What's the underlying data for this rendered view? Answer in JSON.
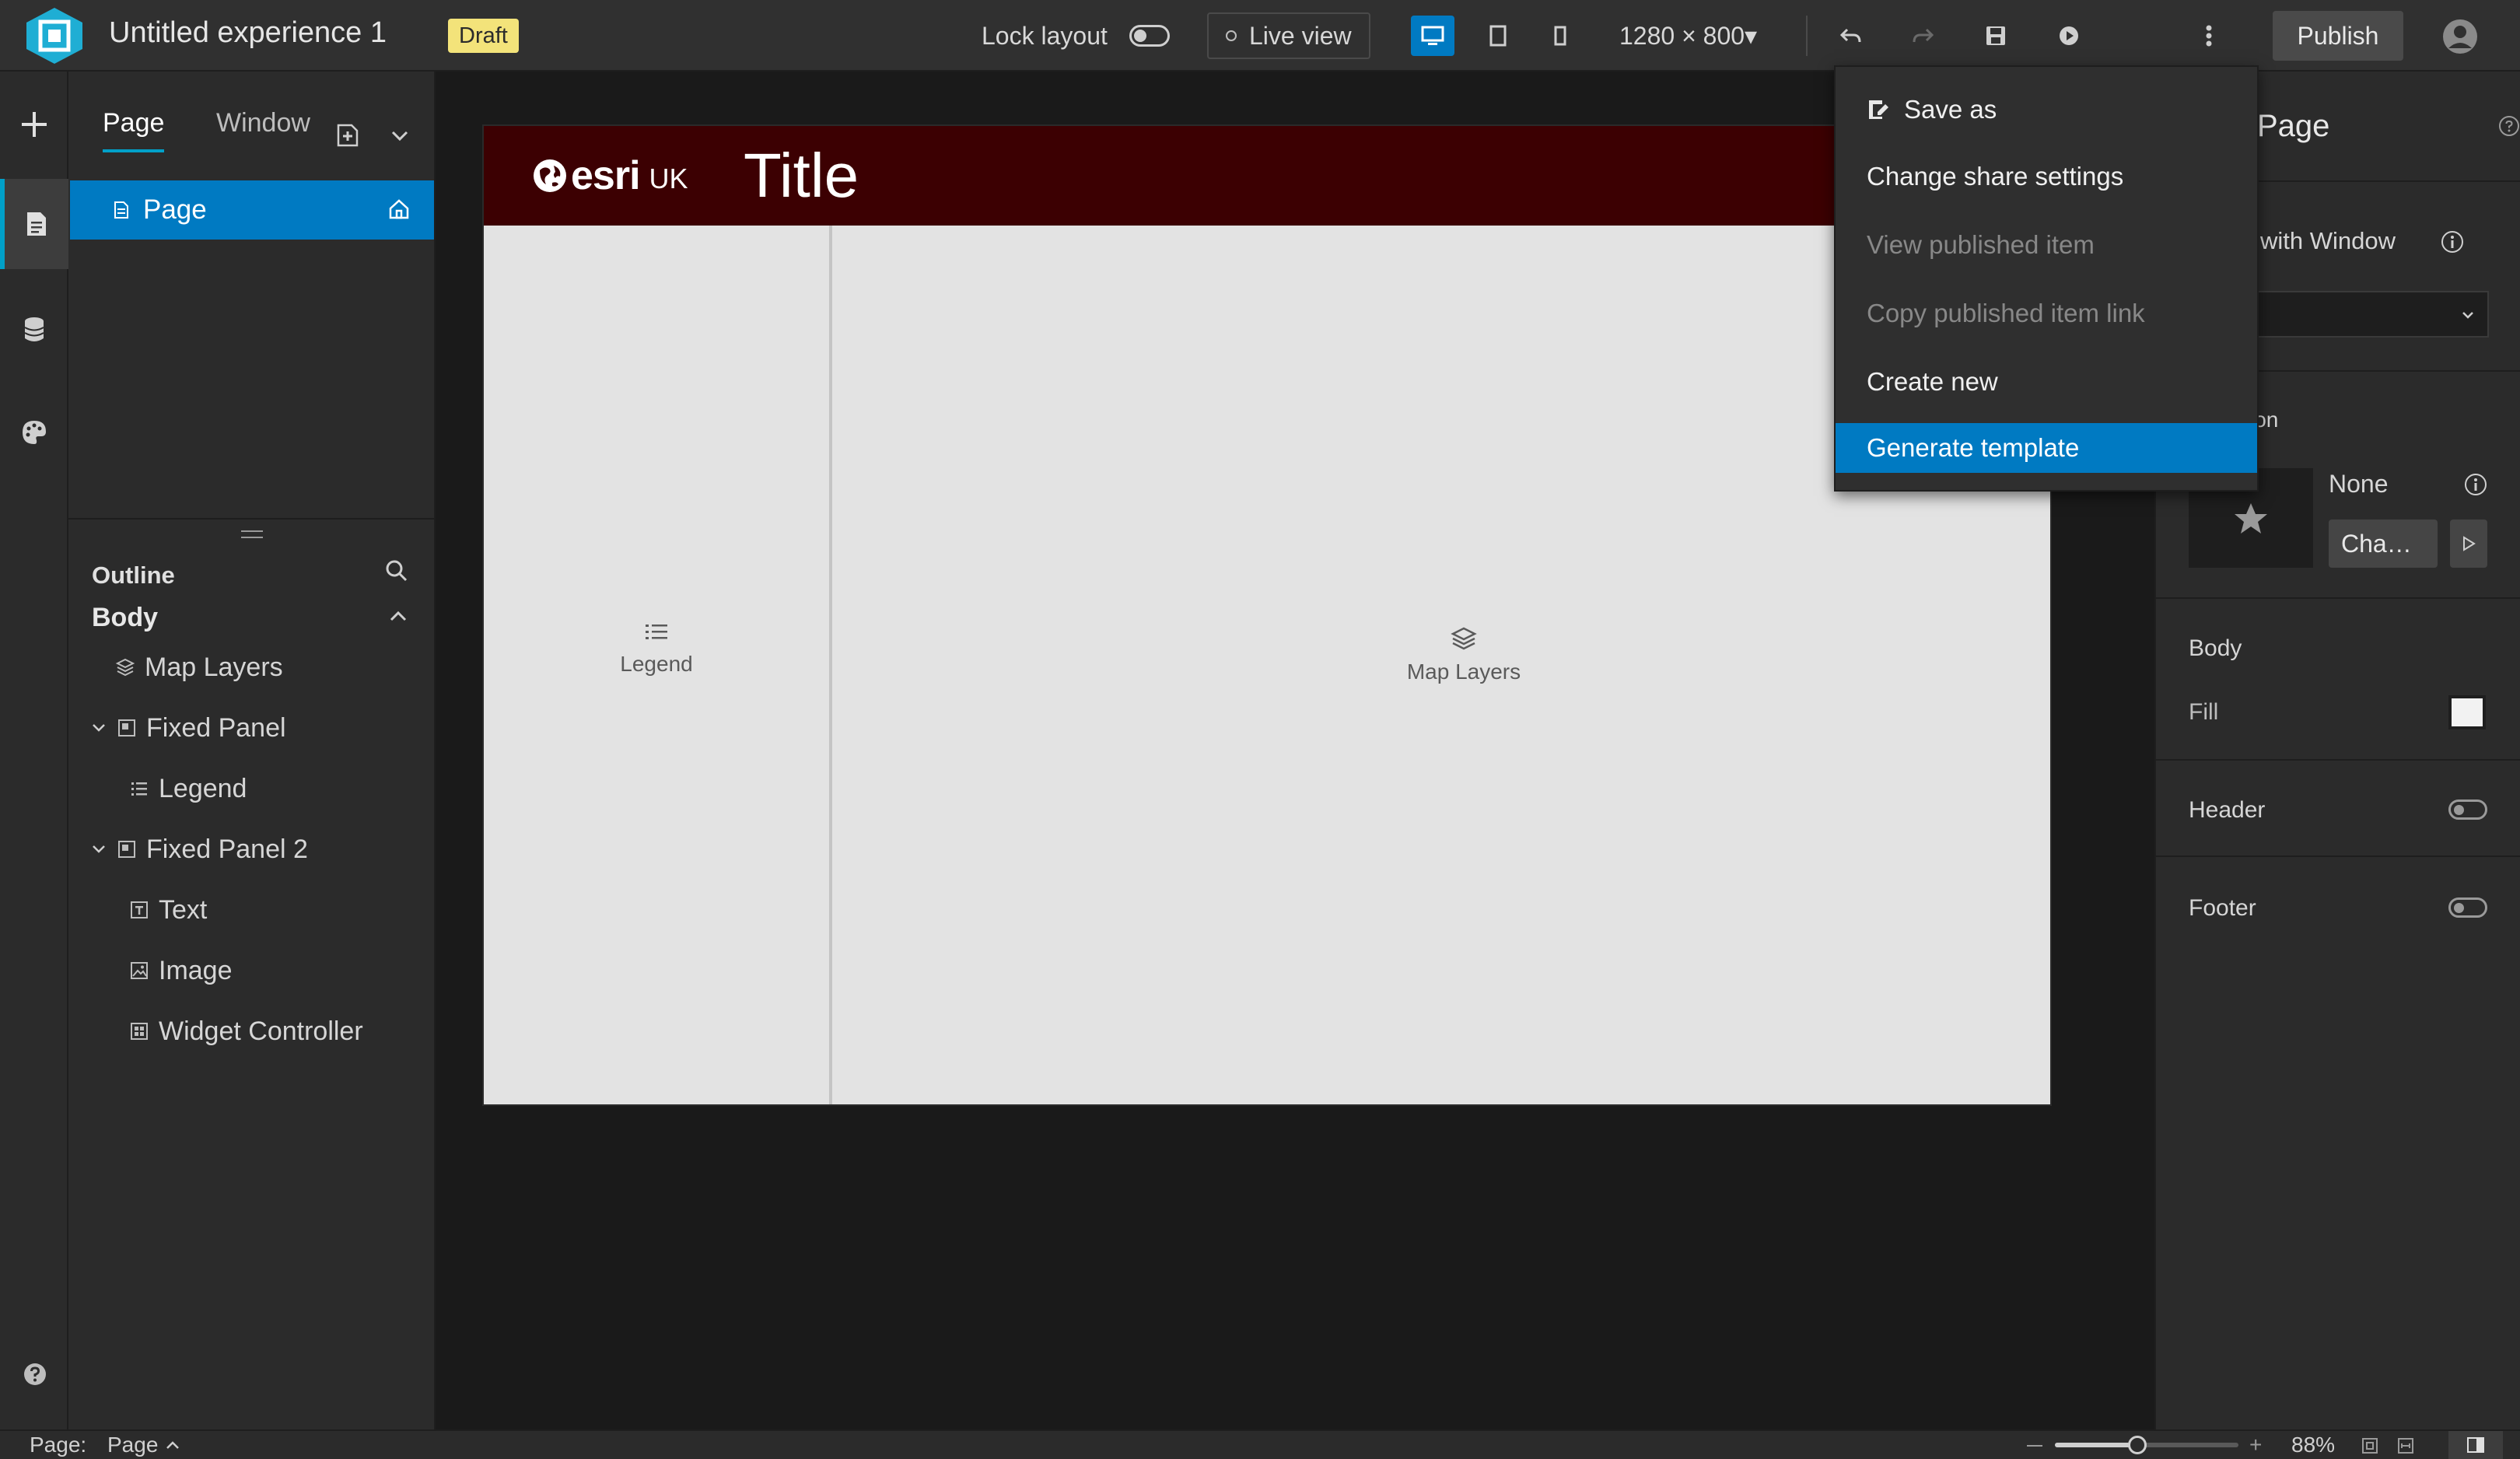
{
  "app": {
    "title": "Untitled experience 1",
    "status_badge": "Draft",
    "accent_color": "#007ac2",
    "badge_color": "#f3e37a"
  },
  "toolbar": {
    "lock_layout_label": "Lock layout",
    "live_view_label": "Live view",
    "resolution": "1280 × 800▾",
    "publish_label": "Publish"
  },
  "left_panel": {
    "tabs": [
      {
        "label": "Page",
        "active": true
      },
      {
        "label": "Window",
        "active": false
      }
    ],
    "pages": [
      {
        "label": "Page",
        "home": true
      }
    ],
    "outline_title": "Outline",
    "body_label": "Body",
    "tree": [
      {
        "label": "Map Layers",
        "icon": "layers-icon",
        "level": 1,
        "expandable": false
      },
      {
        "label": "Fixed Panel",
        "icon": "panel-icon",
        "level": 1,
        "expandable": true
      },
      {
        "label": "Legend",
        "icon": "list-icon",
        "level": 2,
        "expandable": false
      },
      {
        "label": "Fixed Panel 2",
        "icon": "panel-icon",
        "level": 1,
        "expandable": true
      },
      {
        "label": "Text",
        "icon": "text-icon",
        "level": 2,
        "expandable": false
      },
      {
        "label": "Image",
        "icon": "image-icon",
        "level": 2,
        "expandable": false
      },
      {
        "label": "Widget Controller",
        "icon": "widget-controller-icon",
        "level": 2,
        "expandable": false
      }
    ]
  },
  "canvas": {
    "header_title": "Title",
    "header_color": "#3c0002",
    "logo_text": "esri",
    "logo_suffix": "UK",
    "widgets": {
      "legend": "Legend",
      "map_layers": "Map Layers"
    }
  },
  "menu": {
    "items": [
      {
        "label": "Save as",
        "state": "normal",
        "icon": "save-as-icon"
      },
      {
        "label": "Change share settings",
        "state": "normal"
      },
      {
        "label": "View published item",
        "state": "disabled"
      },
      {
        "label": "Copy published item link",
        "state": "disabled"
      },
      {
        "label": "Create new",
        "state": "normal"
      },
      {
        "label": "Generate template",
        "state": "selected"
      }
    ]
  },
  "right_panel": {
    "title": "Page",
    "window_label": "with Window",
    "dropdown_partial": "e",
    "section_partial": "ion",
    "transition_value": "None",
    "change_button": "Cha…",
    "body_section": "Body",
    "fill_label": "Fill",
    "header_label": "Header",
    "footer_label": "Footer"
  },
  "status_bar": {
    "page_label": "Page:",
    "page_value": "Page",
    "zoom": "88%",
    "zoom_level": 0.45
  }
}
